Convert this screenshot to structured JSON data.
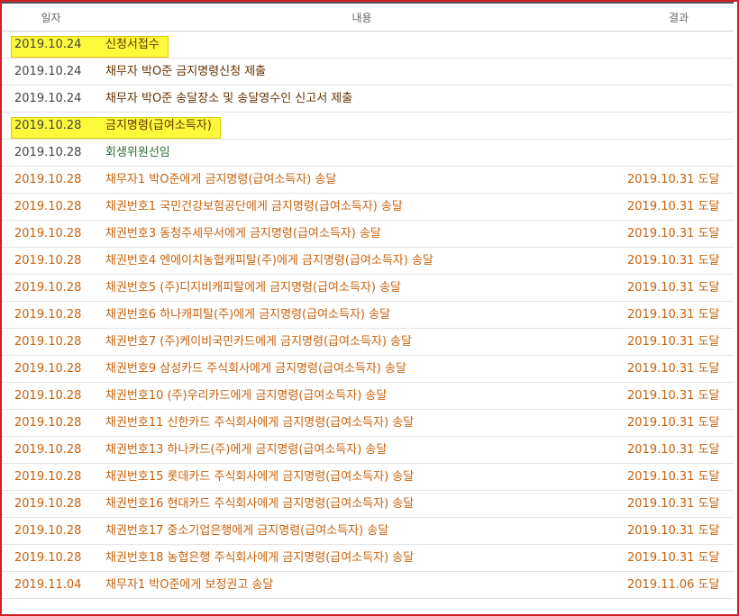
{
  "header": {
    "date": "일자",
    "content": "내용",
    "result": "결과"
  },
  "rows": [
    {
      "date": "2019.10.24",
      "content": "신청서접수",
      "result": "",
      "style": "dark",
      "highlight": true
    },
    {
      "date": "2019.10.24",
      "content": "채무자 박O준 금지명령신청 제출",
      "result": "",
      "style": "dark",
      "highlight": false
    },
    {
      "date": "2019.10.24",
      "content": "채무자 박O준 송달장소 및 송달영수인 신고서 제출",
      "result": "",
      "style": "dark",
      "highlight": false
    },
    {
      "date": "2019.10.28",
      "content": "금지명령(급여소득자)",
      "result": "",
      "style": "dark",
      "highlight": true
    },
    {
      "date": "2019.10.28",
      "content": "회생위원선임",
      "result": "",
      "style": "green",
      "highlight": false
    },
    {
      "date": "2019.10.28",
      "content": "채무자1 박O준에게 금지명령(급여소득자) 송달",
      "result": "2019.10.31 도달",
      "style": "orange",
      "highlight": false
    },
    {
      "date": "2019.10.28",
      "content": "채권번호1 국민건강보험공단에게 금지명령(급여소득자) 송달",
      "result": "2019.10.31 도달",
      "style": "orange",
      "highlight": false
    },
    {
      "date": "2019.10.28",
      "content": "채권번호3 동청주세무서에게 금지명령(급여소득자) 송달",
      "result": "2019.10.31 도달",
      "style": "orange",
      "highlight": false
    },
    {
      "date": "2019.10.28",
      "content": "채권번호4 엔에이치농협캐피탈(주)에게 금지명령(급여소득자) 송달",
      "result": "2019.10.31 도달",
      "style": "orange",
      "highlight": false
    },
    {
      "date": "2019.10.28",
      "content": "채권번호5 (주)디지비캐피탈에게 금지명령(급여소득자) 송달",
      "result": "2019.10.31 도달",
      "style": "orange",
      "highlight": false
    },
    {
      "date": "2019.10.28",
      "content": "채권번호6 하나캐피탈(주)에게 금지명령(급여소득자) 송달",
      "result": "2019.10.31 도달",
      "style": "orange",
      "highlight": false
    },
    {
      "date": "2019.10.28",
      "content": "채권번호7 (주)케이비국민카드에게 금지명령(급여소득자) 송달",
      "result": "2019.10.31 도달",
      "style": "orange",
      "highlight": false
    },
    {
      "date": "2019.10.28",
      "content": "채권번호9 삼성카드 주식회사에게 금지명령(급여소득자) 송달",
      "result": "2019.10.31 도달",
      "style": "orange",
      "highlight": false
    },
    {
      "date": "2019.10.28",
      "content": "채권번호10 (주)우리카드에게 금지명령(급여소득자) 송달",
      "result": "2019.10.31 도달",
      "style": "orange",
      "highlight": false
    },
    {
      "date": "2019.10.28",
      "content": "채권번호11 신한카드 주식회사에게 금지명령(급여소득자) 송달",
      "result": "2019.10.31 도달",
      "style": "orange",
      "highlight": false
    },
    {
      "date": "2019.10.28",
      "content": "채권번호13 하나카드(주)에게 금지명령(급여소득자) 송달",
      "result": "2019.10.31 도달",
      "style": "orange",
      "highlight": false
    },
    {
      "date": "2019.10.28",
      "content": "채권번호15 롯데카드 주식회사에게 금지명령(급여소득자) 송달",
      "result": "2019.10.31 도달",
      "style": "orange",
      "highlight": false
    },
    {
      "date": "2019.10.28",
      "content": "채권번호16 현대카드 주식회사에게 금지명령(급여소득자) 송달",
      "result": "2019.10.31 도달",
      "style": "orange",
      "highlight": false
    },
    {
      "date": "2019.10.28",
      "content": "채권번호17 중소기업은행에게 금지명령(급여소득자) 송달",
      "result": "2019.10.31 도달",
      "style": "orange",
      "highlight": false
    },
    {
      "date": "2019.10.28",
      "content": "채권번호18 농협은행 주식회사에게 금지명령(급여소득자) 송달",
      "result": "2019.10.31 도달",
      "style": "orange",
      "highlight": false
    },
    {
      "date": "2019.11.04",
      "content": "채무자1 박O준에게 보정권고 송달",
      "result": "2019.11.06 도달",
      "style": "orange",
      "highlight": false
    }
  ],
  "colors": {
    "border": "#cf1f25",
    "highlight": "#fff93b",
    "dark_text": "#663300",
    "green_text": "#2e6b3a",
    "orange_text": "#c8620c"
  }
}
